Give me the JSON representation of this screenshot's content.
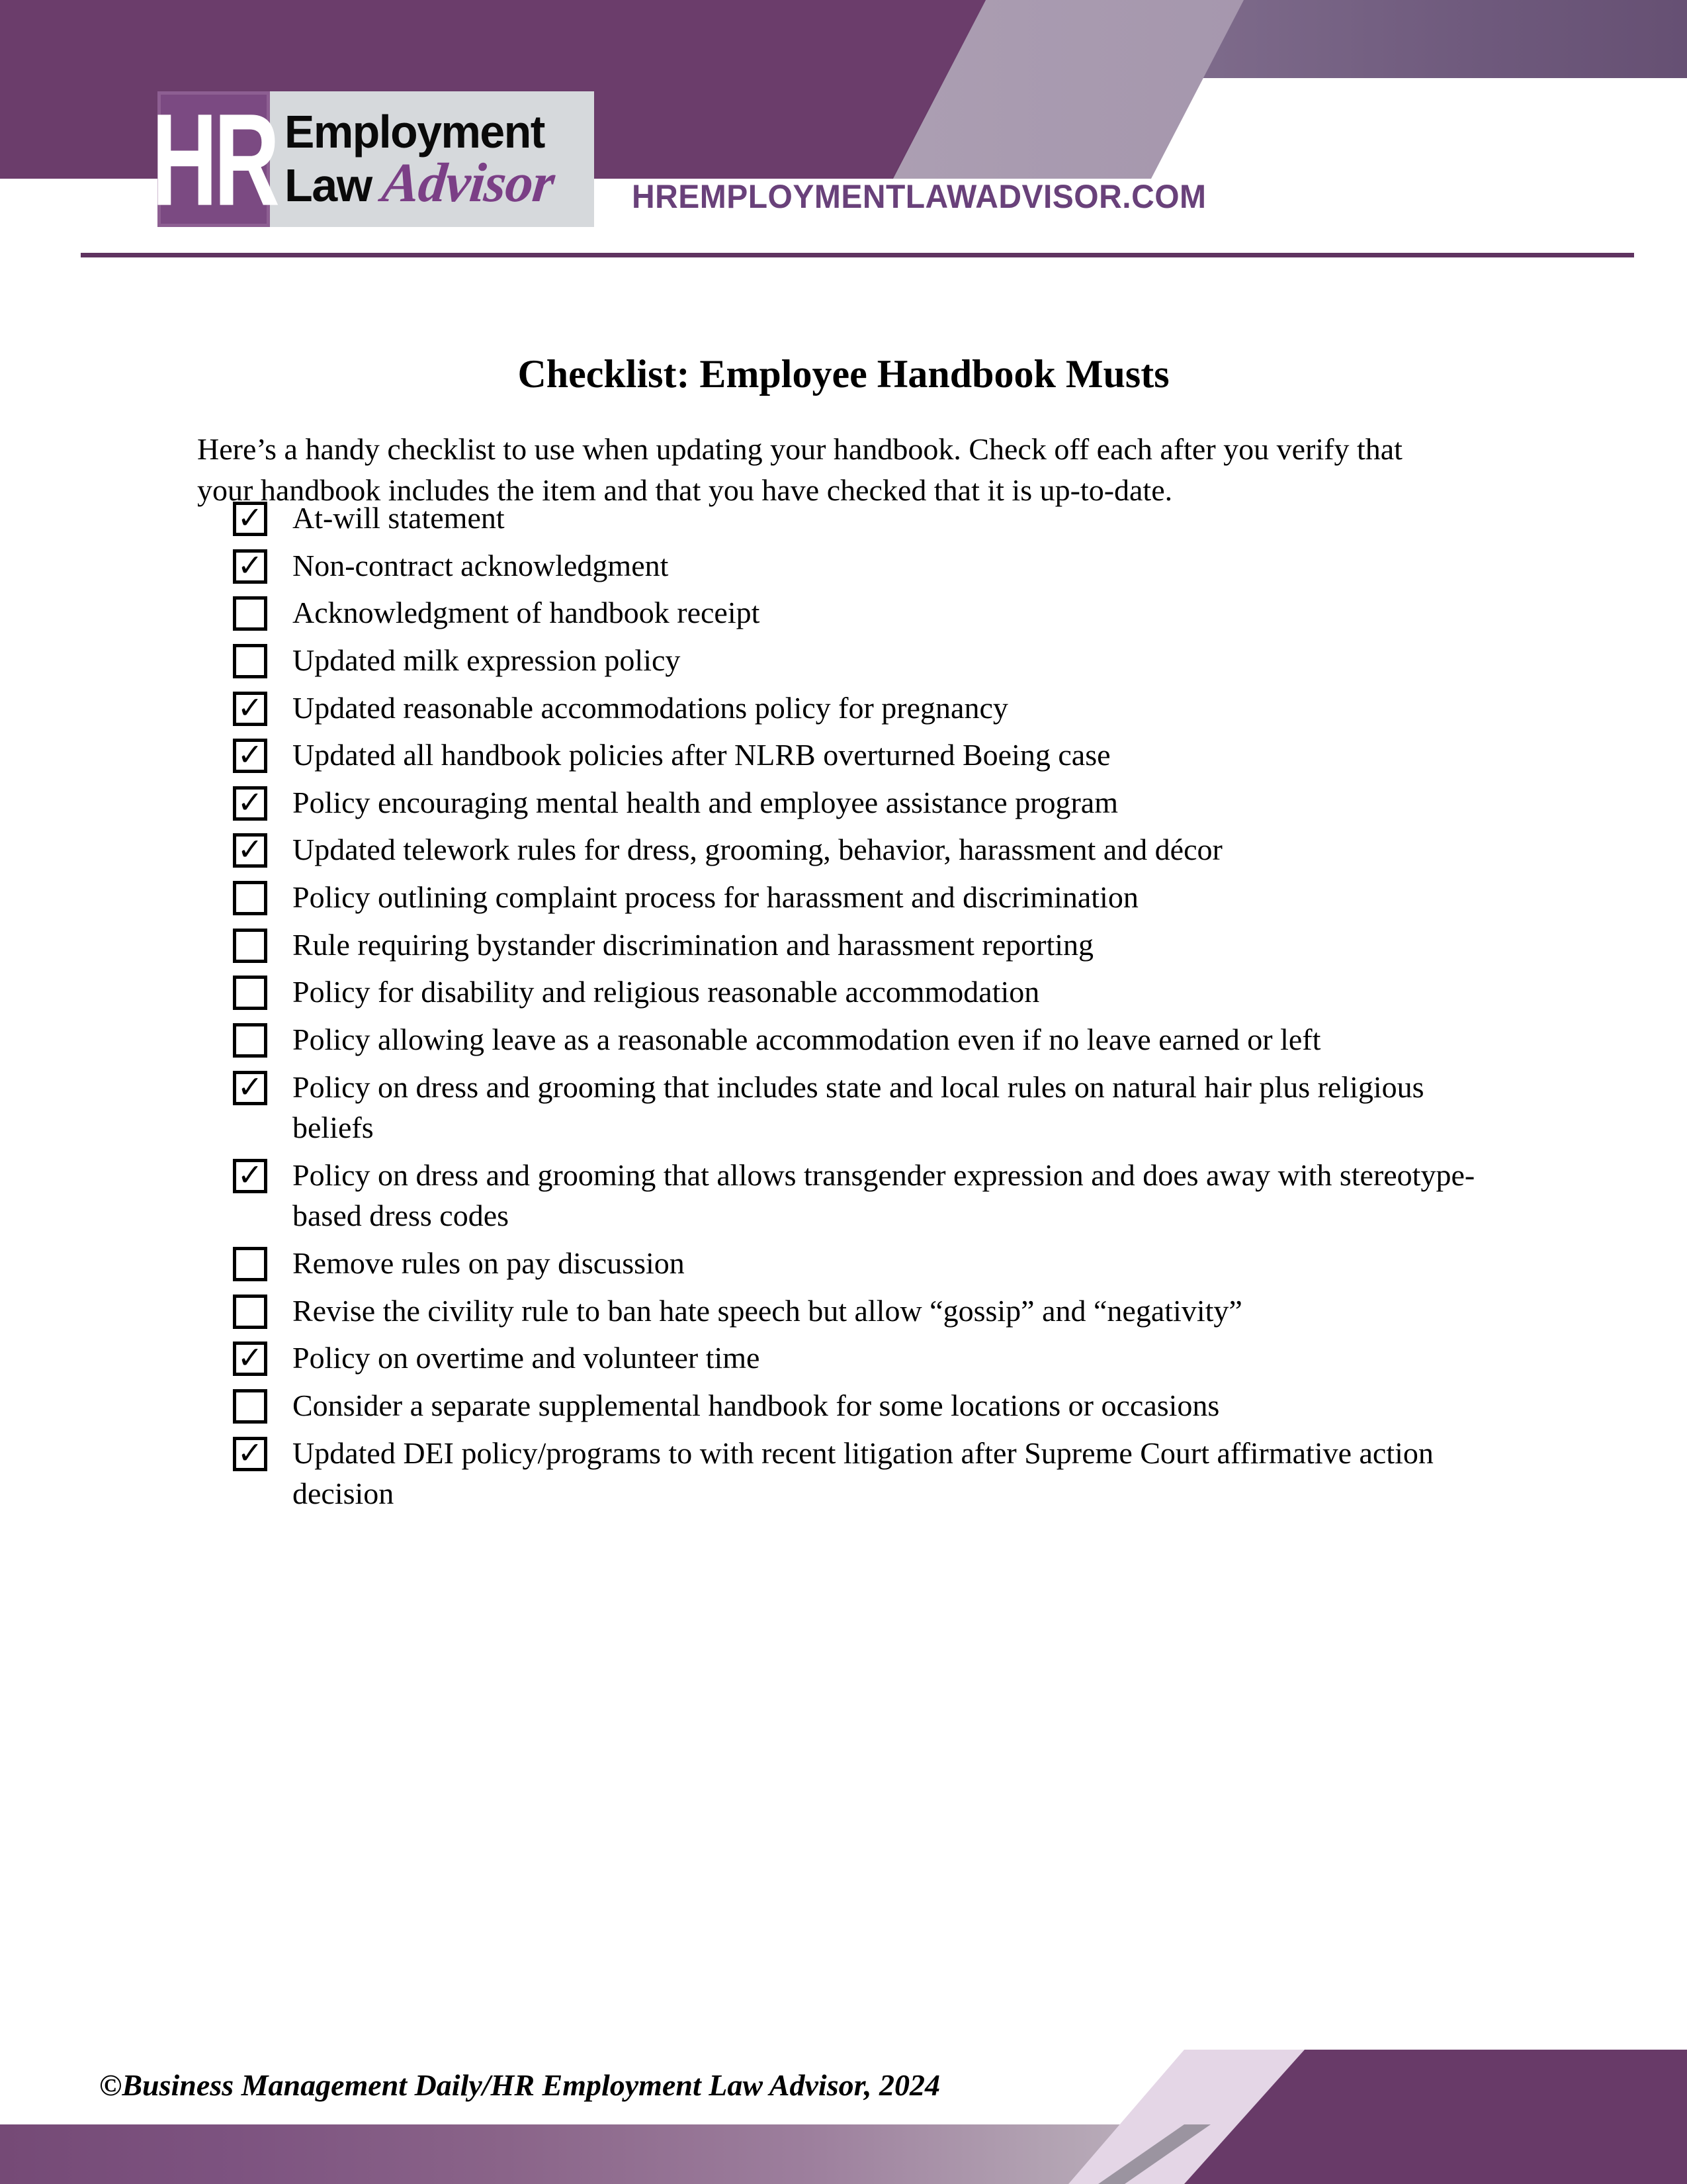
{
  "header": {
    "logo": {
      "monogram": "HR",
      "line1": "Employment",
      "line2_bold": "Law",
      "line2_script": "Advisor"
    },
    "site_url": "HREMPLOYMENTLAWADVISOR.COM",
    "colors": {
      "purple_dark": "#683a68",
      "purple_logo": "#7b4a82",
      "purple_script": "#7b3f86",
      "purple_url": "#69417a",
      "lilac": "#e5d5e5",
      "gray_panel": "#d6d9dc",
      "rule": "#5f3360"
    }
  },
  "document": {
    "title": "Checklist: Employee Handbook Musts",
    "intro": "Here’s a handy checklist to use when updating your handbook. Check off each after you verify that your handbook includes the item and that you have checked that it is up-to-date.",
    "checkmark_glyph": "✓",
    "items": [
      {
        "checked": true,
        "label": "At-will statement"
      },
      {
        "checked": true,
        "label": "Non-contract acknowledgment"
      },
      {
        "checked": false,
        "label": "Acknowledgment of handbook receipt"
      },
      {
        "checked": false,
        "label": "Updated milk expression policy"
      },
      {
        "checked": true,
        "label": "Updated reasonable accommodations policy for pregnancy"
      },
      {
        "checked": true,
        "label": "Updated all handbook policies after NLRB overturned Boeing case"
      },
      {
        "checked": true,
        "label": "Policy encouraging mental health and employee assistance program"
      },
      {
        "checked": true,
        "label": "Updated telework rules for dress, grooming, behavior, harassment and décor"
      },
      {
        "checked": false,
        "label": "Policy outlining complaint process for harassment and discrimination"
      },
      {
        "checked": false,
        "label": "Rule requiring bystander discrimination and harassment reporting"
      },
      {
        "checked": false,
        "label": "Policy for disability and religious reasonable accommodation"
      },
      {
        "checked": false,
        "label": "Policy allowing leave as a reasonable accommodation even if no leave earned or left"
      },
      {
        "checked": true,
        "label": "Policy on dress and grooming that includes state and local rules on natural hair plus religious beliefs"
      },
      {
        "checked": true,
        "label": "Policy on dress and grooming that allows transgender expression and does away with stereotype-based dress codes"
      },
      {
        "checked": false,
        "label": "Remove rules on pay discussion"
      },
      {
        "checked": false,
        "label": "Revise the civility rule to ban hate speech but allow “gossip” and “negativity”"
      },
      {
        "checked": true,
        "label": "Policy on overtime and volunteer time"
      },
      {
        "checked": false,
        "label": "Consider a separate supplemental handbook for some locations or occasions"
      },
      {
        "checked": true,
        "label": "Updated DEI policy/programs to with recent litigation after Supreme Court affirmative action decision"
      }
    ]
  },
  "footer": {
    "copyright": "©Business Management Daily/HR Employment Law Advisor, 2024"
  }
}
